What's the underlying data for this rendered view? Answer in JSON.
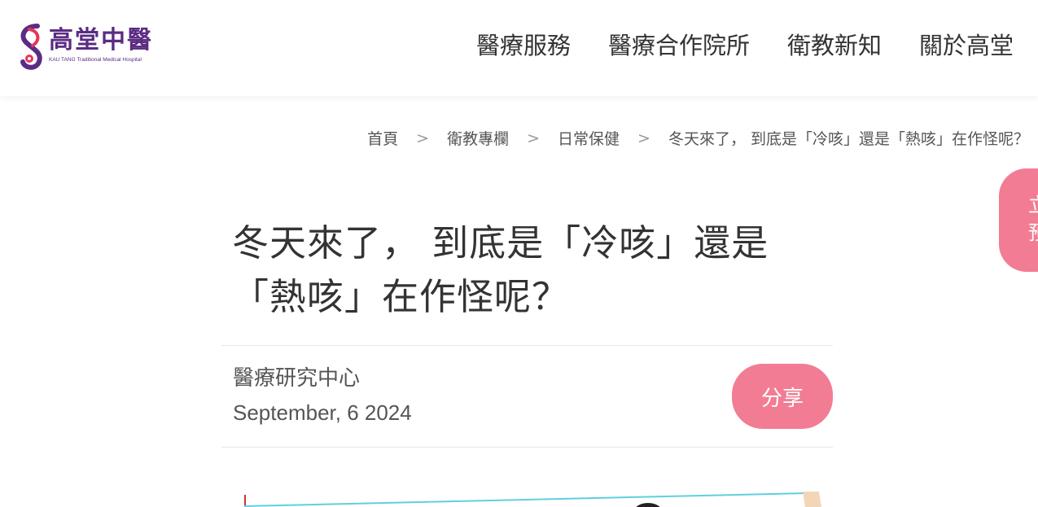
{
  "header": {
    "logo": {
      "title": "高堂中醫",
      "subtitle": "KAU TANG Traditional Medical Hospital",
      "brand_color": "#5b2c83",
      "accent_color": "#e8355a"
    },
    "nav": [
      {
        "label": "醫療服務"
      },
      {
        "label": "醫療合作院所"
      },
      {
        "label": "衛教新知"
      },
      {
        "label": "關於高堂"
      }
    ]
  },
  "breadcrumb": {
    "items": [
      {
        "label": "首頁"
      },
      {
        "label": "衛教專欄"
      },
      {
        "label": "日常保健"
      },
      {
        "label": "冬天來了， 到底是「冷咳」還是「熱咳」在作怪呢？"
      }
    ],
    "separator": ">"
  },
  "side_button": {
    "label": "立即預約",
    "color": "#f27c93"
  },
  "article": {
    "title_line1": "冬天來了， 到底是「冷咳」還是",
    "title_line2": "「熱咳」在作怪呢？",
    "author": "醫療研究中心",
    "date": "September, 6 2024",
    "share_label": "分享"
  },
  "theme": {
    "pink": "#f27c93",
    "text": "#333333"
  }
}
